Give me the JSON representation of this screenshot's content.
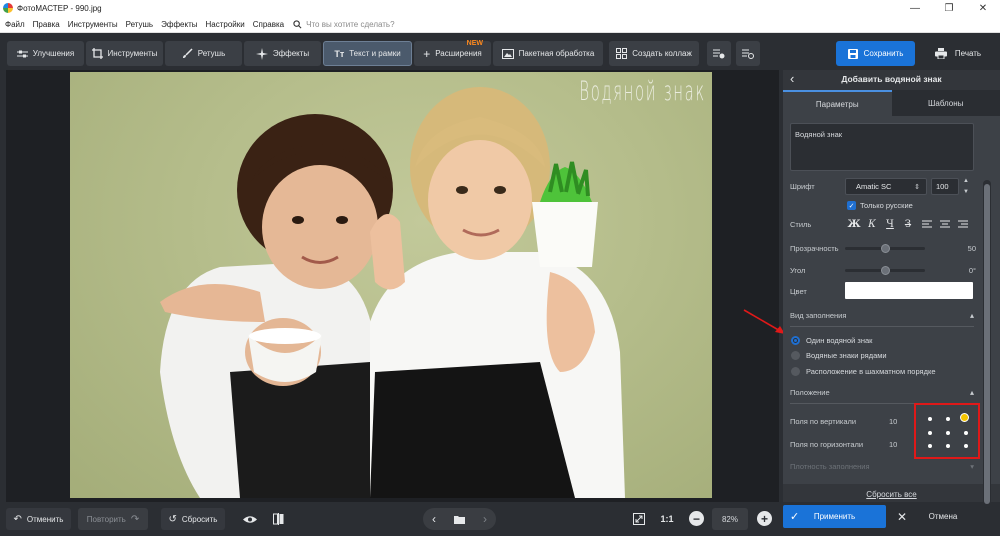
{
  "window": {
    "title": "ФотоМАСТЕР - 990.jpg",
    "minimize": "—",
    "maximize": "❐",
    "close": "✕"
  },
  "menu": {
    "items": [
      "Файл",
      "Правка",
      "Инструменты",
      "Ретушь",
      "Эффекты",
      "Настройки",
      "Справка"
    ],
    "search_placeholder": "Что вы хотите сделать?"
  },
  "toolbar": {
    "tabs": [
      "Улучшения",
      "Инструменты",
      "Ретушь",
      "Эффекты",
      "Текст и рамки",
      "Расширения"
    ],
    "new_badge": "NEW",
    "batch": "Пакетная обработка",
    "collage": "Создать коллаж",
    "save": "Сохранить",
    "print": "Печать"
  },
  "canvas": {
    "watermark_text": "Водяной знак"
  },
  "bottom": {
    "undo": "Отменить",
    "redo": "Повторить",
    "reset": "Сбросить",
    "ratio": "1:1",
    "zoom": "82%"
  },
  "panel": {
    "title": "Добавить водяной знак",
    "tabs": [
      "Параметры",
      "Шаблоны"
    ],
    "text_value": "Водяной знак",
    "font_label": "Шрифт",
    "font_value": "Amatic SC",
    "font_size": "100",
    "only_russian": "Только русские",
    "style_label": "Стиль",
    "opacity_label": "Прозрачность",
    "opacity_value": "50",
    "angle_label": "Угол",
    "angle_value": "0°",
    "color_label": "Цвет",
    "color_value": "#ffffff",
    "fill_section": "Вид заполнения",
    "fill_options": [
      "Один водяной знак",
      "Водяные знаки рядами",
      "Расположение в шахматном порядке"
    ],
    "fill_selected": 0,
    "position_section": "Положение",
    "margin_v_label": "Поля по вертикали",
    "margin_v_value": "10",
    "margin_h_label": "Поля по горизонтали",
    "margin_h_value": "10",
    "position_selected": "top-right",
    "density_label": "Плотность заполнения",
    "reset_all": "Сбросить все"
  },
  "actions": {
    "apply": "Применить",
    "cancel": "Отмена"
  }
}
